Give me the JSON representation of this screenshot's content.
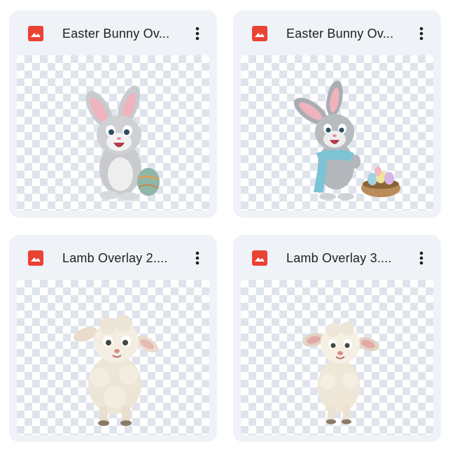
{
  "files": [
    {
      "title": "Easter Bunny Ov...",
      "file_type_icon": "image-icon",
      "more_icon": "more-vert-icon",
      "thumbnail": "bunny-with-egg"
    },
    {
      "title": "Easter Bunny Ov...",
      "file_type_icon": "image-icon",
      "more_icon": "more-vert-icon",
      "thumbnail": "bunny-with-basket"
    },
    {
      "title": "Lamb Overlay 2....",
      "file_type_icon": "image-icon",
      "more_icon": "more-vert-icon",
      "thumbnail": "lamb"
    },
    {
      "title": "Lamb Overlay 3....",
      "file_type_icon": "image-icon",
      "more_icon": "more-vert-icon",
      "thumbnail": "lamb"
    }
  ],
  "colors": {
    "card_bg": "#eff2f7",
    "image_icon": "#ea4335",
    "title_text": "#1f1f1f",
    "checker": "#dfe4ec"
  }
}
